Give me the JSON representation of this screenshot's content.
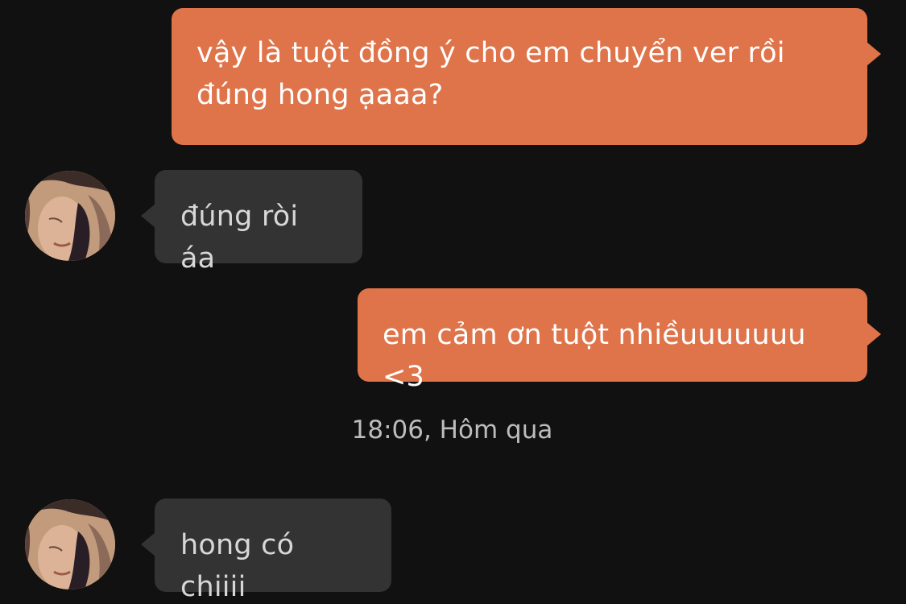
{
  "theme": {
    "background": "#111111",
    "outgoing_bubble": "#df744a",
    "incoming_bubble": "#333333"
  },
  "messages": [
    {
      "direction": "outgoing",
      "text": "vậy là tuột đồng ý cho em chuyển ver rồi đúng hong ạaaa?"
    },
    {
      "direction": "incoming",
      "text": "đúng ròi áa",
      "avatar": "contact-avatar"
    },
    {
      "direction": "outgoing",
      "text": "em cảm ơn tuột nhiềuuuuuuu <3"
    },
    {
      "direction": "incoming",
      "text": "hong có chiiii",
      "avatar": "contact-avatar"
    }
  ],
  "timestamp": "18:06, Hôm qua"
}
